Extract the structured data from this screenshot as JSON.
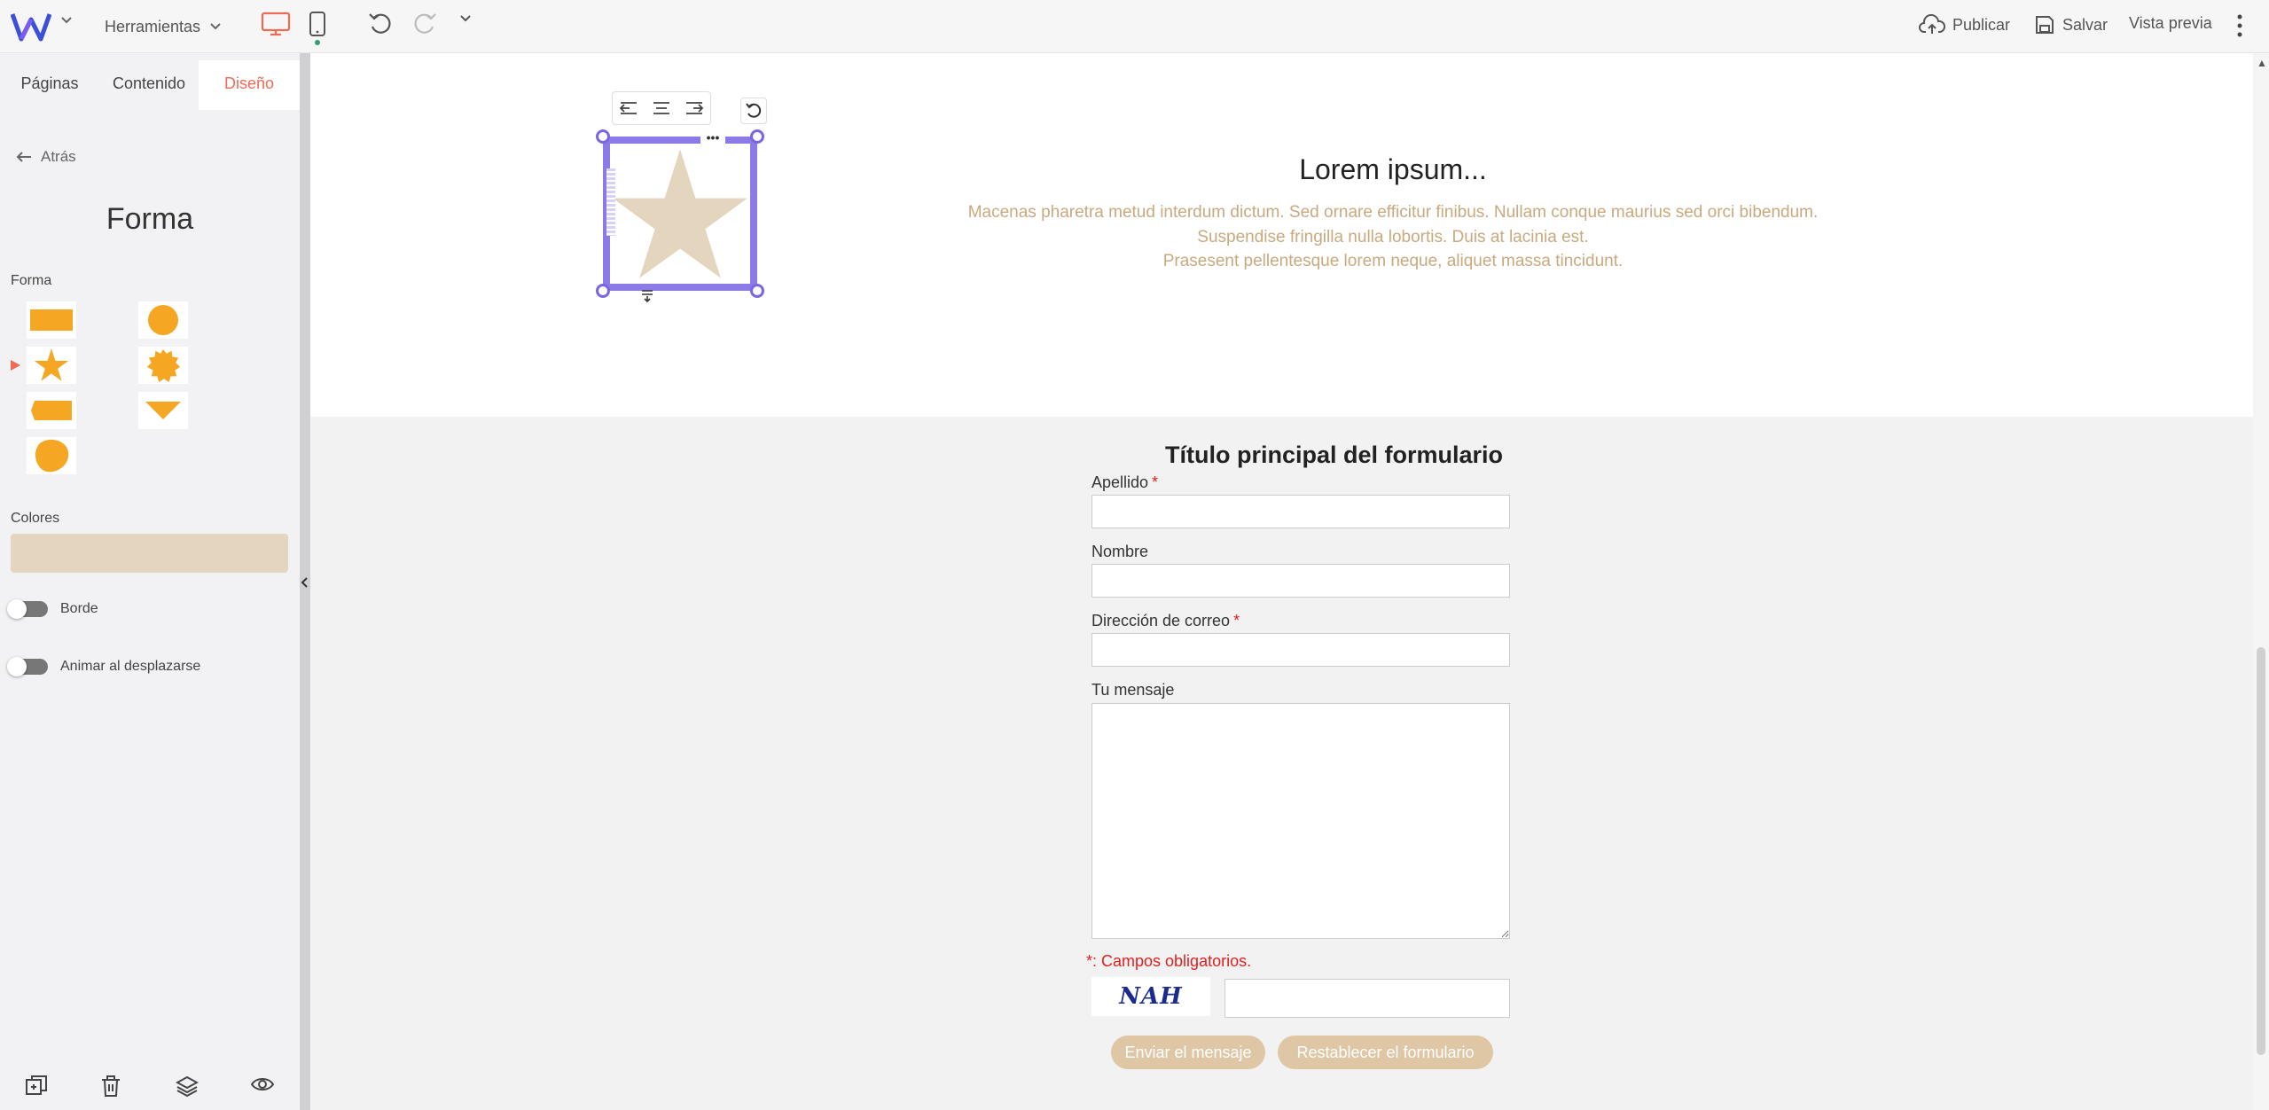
{
  "colors": {
    "accent": "#f06a55",
    "shape_fill": "#e3d5be",
    "shape_icon": "#f5a623",
    "selection": "#8c7ae6",
    "body_text": "#c9a97e",
    "button_fill": "#dfc7a6",
    "required": "#e02020"
  },
  "topbar": {
    "tools_label": "Herramientas",
    "publish_label": "Publicar",
    "save_label": "Salvar",
    "preview_label": "Vista previa",
    "icons": [
      "logo-w-icon",
      "chevron-down-icon",
      "desktop-icon",
      "mobile-icon",
      "undo-icon",
      "redo-icon",
      "cloud-upload-icon",
      "save-icon",
      "more-vertical-icon"
    ]
  },
  "sidebar": {
    "tabs": [
      {
        "label": "Páginas",
        "active": false
      },
      {
        "label": "Contenido",
        "active": false
      },
      {
        "label": "Diseño",
        "active": true
      }
    ],
    "back_label": "Atrás",
    "title": "Forma",
    "shape_section_label": "Forma",
    "shapes": [
      "rectangle",
      "circle",
      "star",
      "seal",
      "tag",
      "triangle",
      "blob"
    ],
    "selected_shape": "star",
    "colors_label": "Colores",
    "border_label": "Borde",
    "border_enabled": false,
    "animate_label": "Animar al desplazarse",
    "animate_enabled": false,
    "bottom_icons": [
      "duplicate-icon",
      "trash-icon",
      "layers-icon",
      "eye-icon"
    ]
  },
  "hero": {
    "heading": "Lorem ipsum...",
    "line1": "Macenas pharetra metud interdum dictum. Sed ornare efficitur finibus. Nullam conque maurius sed orci bibendum.",
    "line2": "Suspendise fringilla nulla lobortis. Duis at lacinia est.",
    "line3": "Prasesent pellentesque lorem neque, aliquet massa tincidunt."
  },
  "form": {
    "title": "Título principal del formulario",
    "fields": [
      {
        "label": "Apellido",
        "required": true,
        "value": ""
      },
      {
        "label": "Nombre",
        "required": false,
        "value": ""
      },
      {
        "label": "Dirección de correo",
        "required": true,
        "value": ""
      },
      {
        "label": "Tu mensaje",
        "required": false,
        "value": ""
      }
    ],
    "required_marker": "*",
    "required_note": "*: Campos obligatorios.",
    "captcha_text": "NAH",
    "captcha_value": "",
    "send_label": "Enviar el mensaje",
    "reset_label": "Restablecer el formulario"
  }
}
